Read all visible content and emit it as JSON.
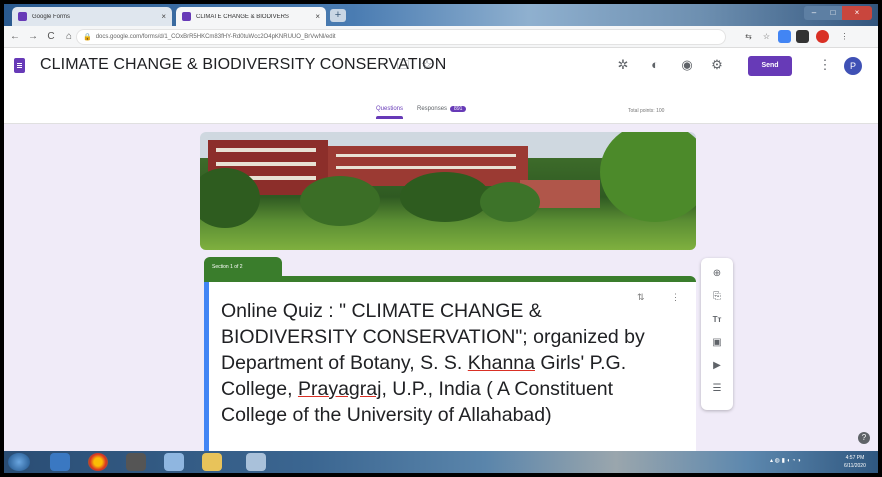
{
  "browser": {
    "tabs": [
      {
        "label": "Google Forms",
        "close": "×"
      },
      {
        "label": "CLIMATE CHANGE & BIODIVERS",
        "close": "×"
      }
    ],
    "new_tab": "+",
    "url": "docs.google.com/forms/d/1_COxBrR5HKCm83fHY-Rd0tuWcc2O4pKNRUUO_BrVwNl/edit",
    "nav": {
      "back": "←",
      "forward": "→",
      "reload": "C",
      "home": "⌂"
    }
  },
  "form": {
    "title": "CLIMATE CHANGE & BIODIVERSITY CONSERVATION",
    "send_label": "Send",
    "avatar_initial": "P",
    "tabs": {
      "questions": "Questions",
      "responses": "Responses",
      "responses_count": "891"
    },
    "total_points": "Total points: 100",
    "section_label": "Section 1 of 2",
    "quiz_title_parts": [
      "Online Quiz : \" CLIMATE CHANGE & BIODIVERSITY CONSERVATION\"; organized by Department of Botany, S. S. ",
      "Khanna",
      " Girls' P.G. College, ",
      "Prayagraj",
      ", U.P., India ( A Constituent College of the University of Allahabad)"
    ]
  },
  "taskbar": {
    "clock_time": "4:57 PM",
    "clock_date": "6/11/2020"
  },
  "colors": {
    "accent": "#673ab7",
    "section_green": "#3a7d2c",
    "question_blue": "#4285f4"
  }
}
